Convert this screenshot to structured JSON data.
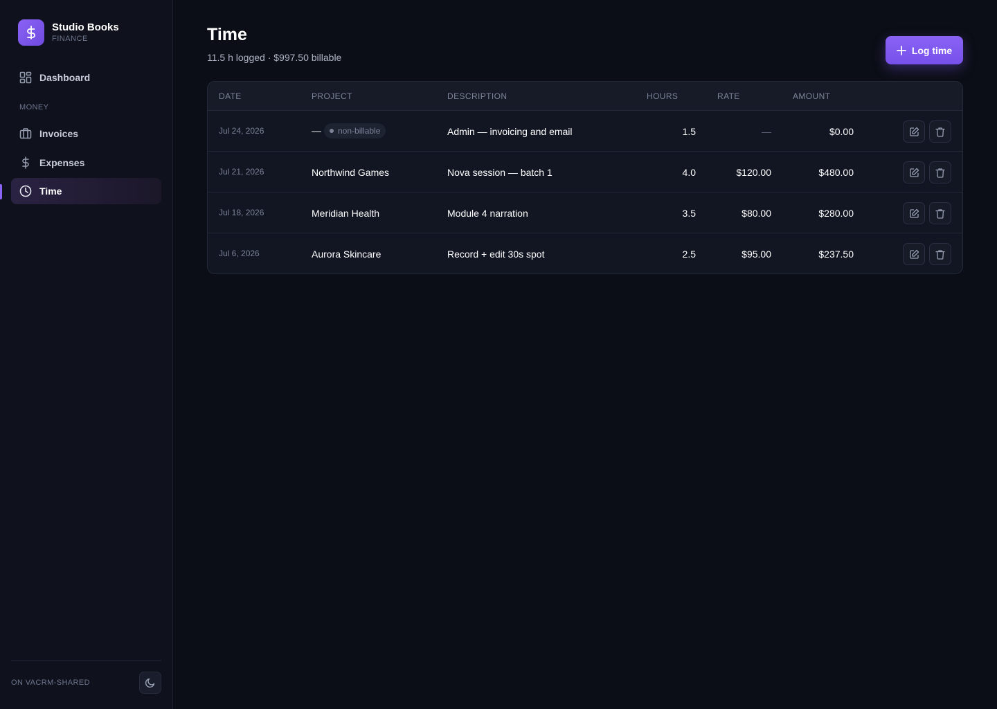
{
  "brand": {
    "name": "Studio Books",
    "subtitle": "FINANCE",
    "logo_icon": "dollar-icon"
  },
  "sidebar": {
    "items": [
      {
        "label": "Dashboard",
        "icon": "dashboard-grid-icon",
        "active": false
      },
      {
        "label": "Invoices",
        "icon": "briefcase-icon",
        "active": false
      },
      {
        "label": "Expenses",
        "icon": "dollar-icon",
        "active": false
      },
      {
        "label": "Time",
        "icon": "clock-icon",
        "active": true
      }
    ],
    "section_label": "MONEY",
    "footer_label": "ON VACRM-SHARED",
    "theme_toggle_icon": "moon-icon"
  },
  "header": {
    "title": "Time",
    "subtitle": "11.5 h logged · $997.50 billable",
    "primary_button": "Log time"
  },
  "table": {
    "columns": [
      "DATE",
      "PROJECT",
      "DESCRIPTION",
      "HOURS",
      "RATE",
      "AMOUNT"
    ],
    "rows": [
      {
        "date": "Jul 24, 2026",
        "project": "—",
        "tag": "non-billable",
        "description": "Admin — invoicing and email",
        "hours": "1.5",
        "rate": "—",
        "amount": "$0.00"
      },
      {
        "date": "Jul 21, 2026",
        "project": "Northwind Games",
        "tag": "",
        "description": "Nova session — batch 1",
        "hours": "4.0",
        "rate": "$120.00",
        "amount": "$480.00"
      },
      {
        "date": "Jul 18, 2026",
        "project": "Meridian Health",
        "tag": "",
        "description": "Module 4 narration",
        "hours": "3.5",
        "rate": "$80.00",
        "amount": "$280.00"
      },
      {
        "date": "Jul 6, 2026",
        "project": "Aurora Skincare",
        "tag": "",
        "description": "Record + edit 30s spot",
        "hours": "2.5",
        "rate": "$95.00",
        "amount": "$237.50"
      }
    ]
  },
  "colors": {
    "accent": "#8a63f5",
    "background": "#0b0e16",
    "sidebar": "#0f121c"
  }
}
